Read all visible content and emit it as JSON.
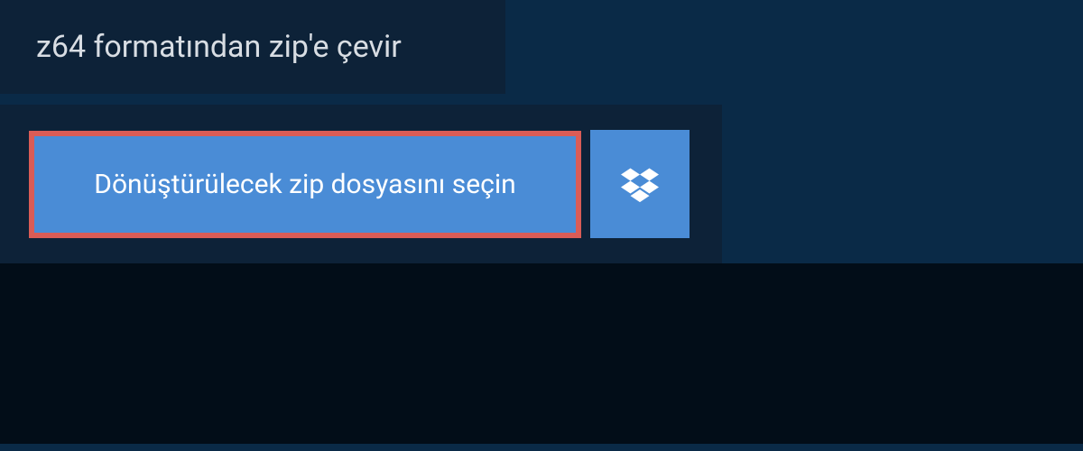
{
  "header": {
    "title": "z64 formatından zip'e çevir"
  },
  "main": {
    "select_button_label": "Dönüştürülecek zip dosyasını seçin",
    "dropbox_icon_name": "dropbox-icon"
  },
  "colors": {
    "page_bg": "#0a2a47",
    "panel_bg": "#0d2238",
    "button_bg": "#4a8cd6",
    "button_border": "#da5c56",
    "bottom_bg": "#020d18",
    "text_light": "#d8dde3",
    "text_white": "#ffffff"
  }
}
